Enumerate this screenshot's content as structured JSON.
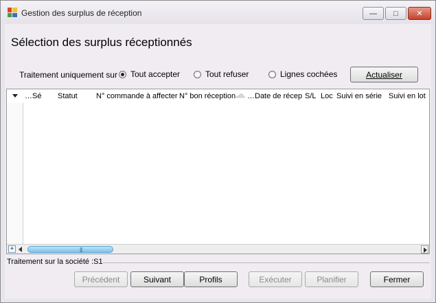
{
  "window": {
    "title": "Gestion des surplus de réception",
    "controls": {
      "minimize": "—",
      "maximize": "□",
      "close": "✕"
    }
  },
  "page": {
    "title": "Sélection des surplus réceptionnés"
  },
  "filter": {
    "label": "Traitement uniquement sur :",
    "options": [
      {
        "label": "Tout accepter",
        "checked": true
      },
      {
        "label": "Tout refuser",
        "checked": false
      },
      {
        "label": "Lignes cochées",
        "checked": false
      }
    ],
    "refresh_label": "Actualiser"
  },
  "grid": {
    "columns": [
      "…Sé",
      "Statut",
      "N° commande à affecter",
      "N° bon réception",
      "…Date de récep",
      "S/L",
      "Loc",
      "Suivi en série",
      "Suivi en lot"
    ],
    "rows": [],
    "scroll_plus": "+",
    "scroll_grip": "|||"
  },
  "footer": {
    "company_text": "Traitement sur la société :S1"
  },
  "buttons": {
    "previous": "Précédent",
    "next": "Suivant",
    "profiles": "Profils",
    "execute": "Exécuter",
    "plan": "Planifier",
    "close": "Fermer"
  },
  "icons": {
    "app": "app-icon",
    "sort_indicator": "sort-indicator-icon"
  }
}
